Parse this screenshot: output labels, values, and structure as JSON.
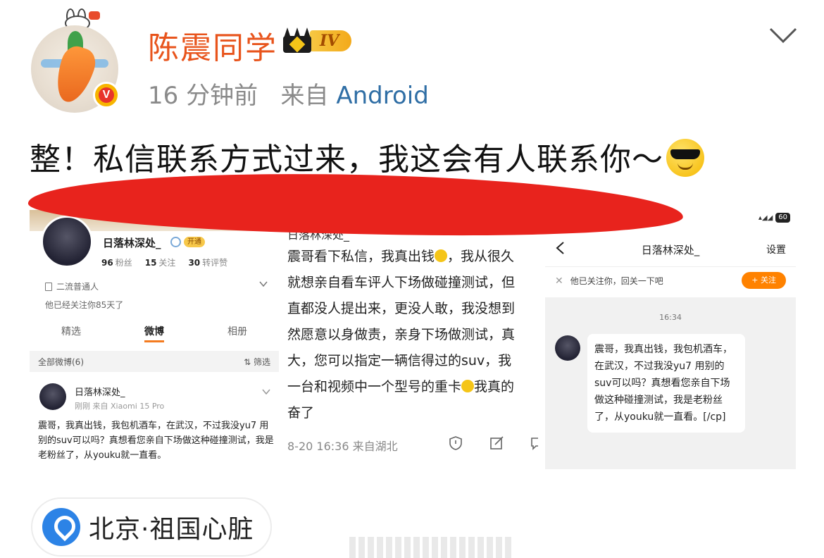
{
  "header": {
    "username": "陈震同学",
    "vip_level": "IV",
    "time": "16 分钟前",
    "source_prefix": "来自",
    "source": "Android"
  },
  "post": {
    "text": "整！私信联系方式过来，我这会有人联系你～"
  },
  "screenshot_profile": {
    "nickname": "日落林深处_",
    "badge_text": "开通",
    "fans_count": "96",
    "fans_label": "粉丝",
    "following_count": "15",
    "following_label": "关注",
    "likes_count": "30",
    "likes_label": "转评赞",
    "tag": "二流普通人",
    "follow_days": "他已经关注你85天了",
    "tabs": [
      "精选",
      "微博",
      "相册"
    ],
    "all_weibo": "全部微博(6)",
    "filter": "筛选",
    "mini_post": {
      "name": "日落林深处_",
      "meta": "刚刚  来自 Xiaomi 15 Pro",
      "text": "震哥，我真出钱，我包机酒车，在武汉，不过我没yu7 用别的suv可以吗？真想看您亲自下场做这种碰撞测试，我是老粉丝了，从youku就一直看。"
    }
  },
  "screenshot_post": {
    "name": "日落林深处_",
    "line1": "震哥看下私信，我真出钱",
    "line1b": "，我从很久",
    "line2": "就想亲自看车评人下场做碰撞测试，但",
    "line3": "直都没人提出来，更没人敢，我没想到",
    "line4": "然愿意以身做责，亲身下场做测试，真",
    "line5": "大，您可以指定一辆信得过的suv，我",
    "line6": "一台和视频中一个型号的重卡",
    "line6b": "我真的",
    "line7": "奋了",
    "meta": "8-20 16:36  来自湖北"
  },
  "screenshot_chat": {
    "battery": "60",
    "title": "日落林深处_",
    "settings": "设置",
    "notice": "他已关注你，回关一下吧",
    "follow_btn": "+ 关注",
    "time": "16:34",
    "message": "震哥，我真出钱，我包机酒车，在武汉，不过我没yu7 用别的suv可以吗？真想看您亲自下场做这种碰撞测试，我是老粉丝了，从youku就一直看。[/cp]"
  },
  "location": {
    "text": "北京·祖国心脏"
  },
  "colors": {
    "username": "#e8541c",
    "source_link": "#2f6ea5",
    "red_highlight": "#e8231d",
    "location_pin": "#2c83e6"
  }
}
